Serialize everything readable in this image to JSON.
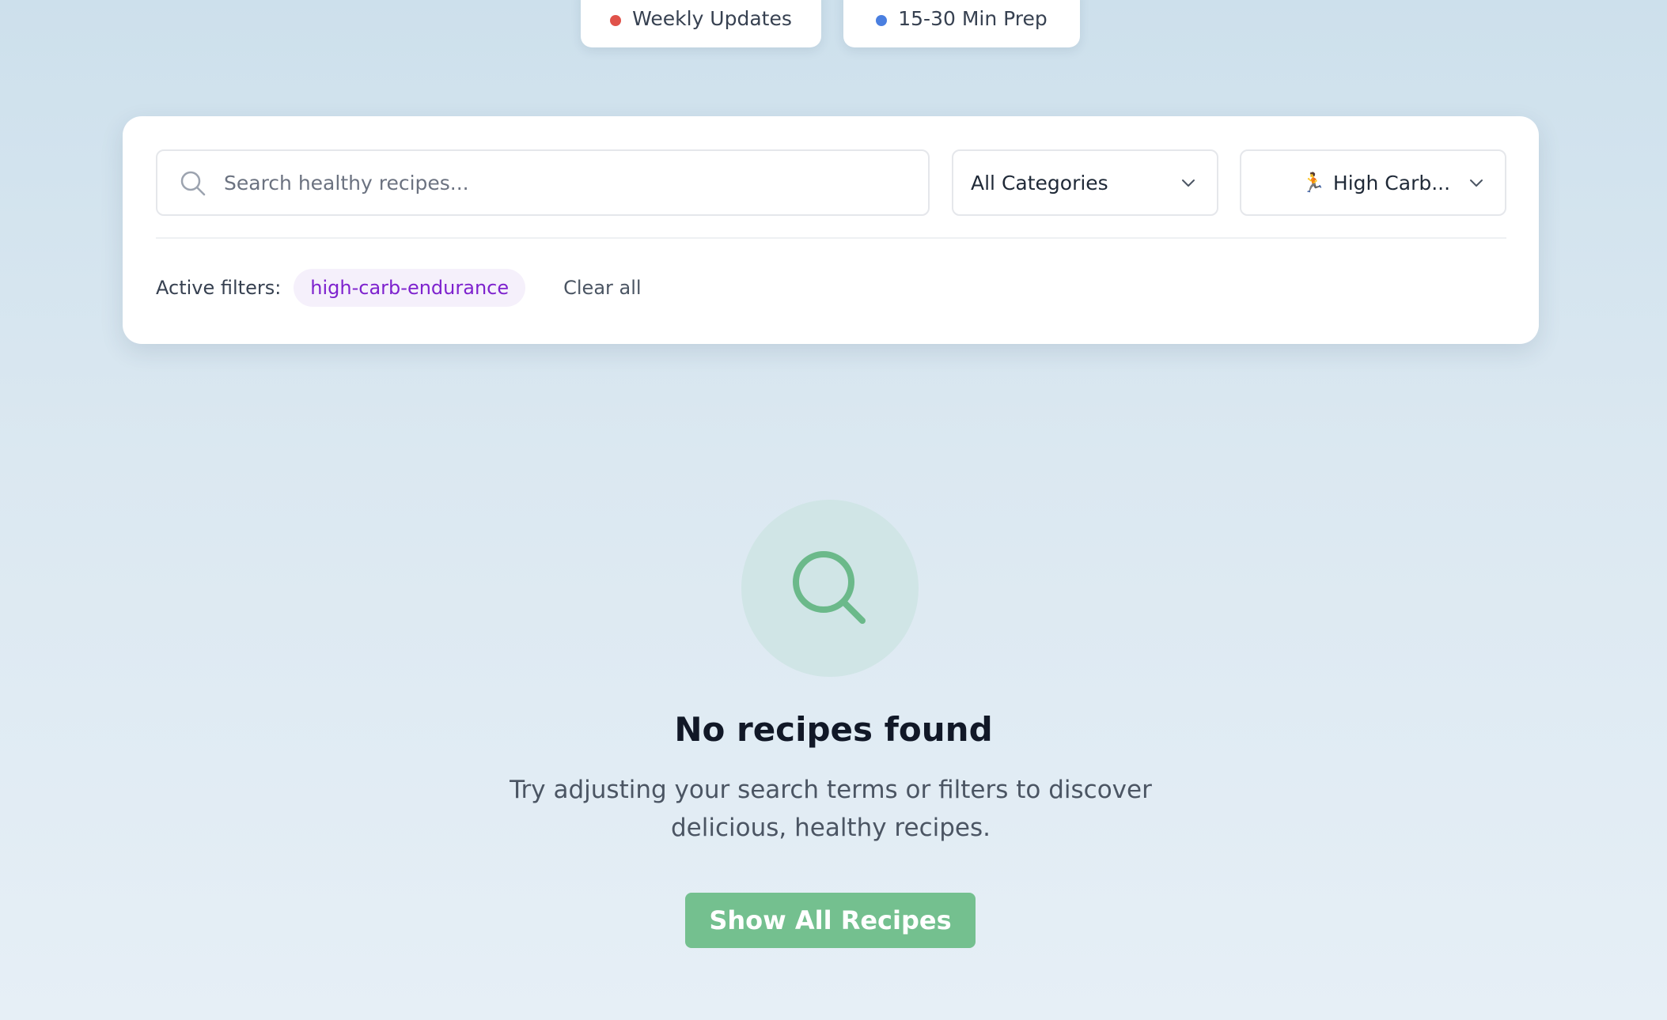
{
  "badges": [
    {
      "label": "Weekly Updates",
      "dot_color": "#e0524a"
    },
    {
      "label": "15-30 Min Prep",
      "dot_color": "#4a7fe0"
    }
  ],
  "filters": {
    "search_placeholder": "Search healthy recipes...",
    "search_value": "",
    "category_select": {
      "selected": "All Categories"
    },
    "diet_select": {
      "selected_icon": "runner-emoji",
      "selected_emoji": "🏃",
      "selected": "High Carb..."
    },
    "active_label": "Active filters:",
    "active_chips": [
      "high-carb-endurance"
    ],
    "clear_all_label": "Clear all"
  },
  "empty_state": {
    "icon": "search-icon",
    "title": "No recipes found",
    "message": "Try adjusting your search terms or filters to discover delicious, healthy recipes.",
    "button_label": "Show All Recipes"
  },
  "colors": {
    "accent_green": "#74c08f",
    "chip_purple": "#7e22ce",
    "chip_bg": "#f5f0fb"
  }
}
